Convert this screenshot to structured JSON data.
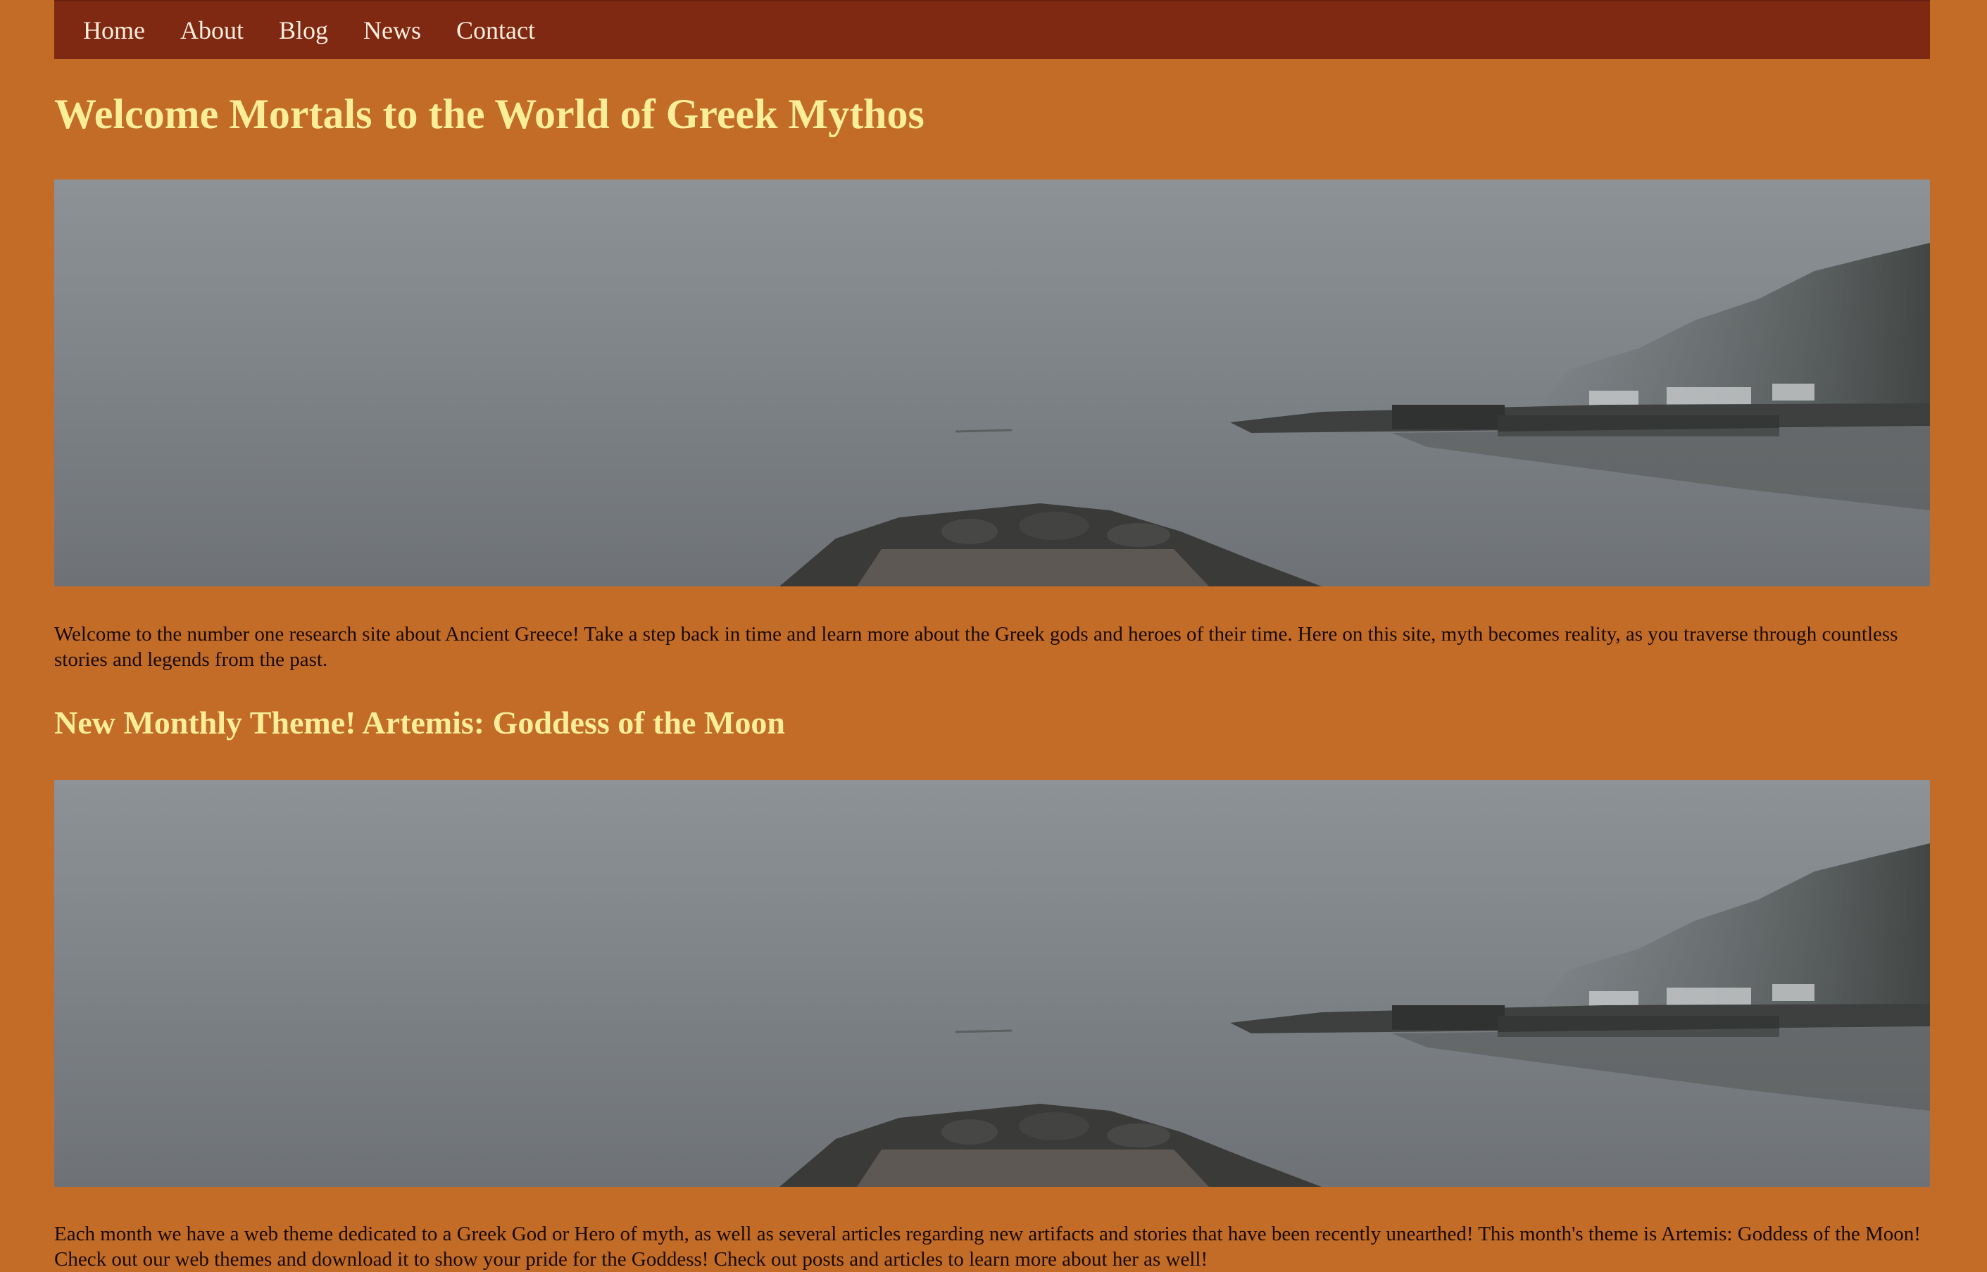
{
  "nav": {
    "items": [
      {
        "label": "Home"
      },
      {
        "label": "About"
      },
      {
        "label": "Blog"
      },
      {
        "label": "News"
      },
      {
        "label": "Contact"
      }
    ]
  },
  "main": {
    "title": "Welcome Mortals to the World of Greek Mythos",
    "intro": "Welcome to the number one research site about Ancient Greece! Take a step back in time and learn more about the Greek gods and heroes of their time. Here on this site, myth becomes reality, as you traverse through countless stories and legends from the past.",
    "theme_heading": "New Monthly Theme! Artemis: Goddess of the Moon",
    "theme_text": "Each month we have a web theme dedicated to a Greek God or Hero of myth, as well as several articles regarding new artifacts and stories that have been recently unearthed! This month's theme is Artemis: Goddess of the Moon! Check out our web themes and download it to show your pride for the Goddess! Check out posts and articles to learn more about her as well!"
  },
  "colors": {
    "background": "#c26c27",
    "nav_bg": "#7f2912",
    "heading": "#fbee99",
    "nav_text": "#fbeede"
  }
}
